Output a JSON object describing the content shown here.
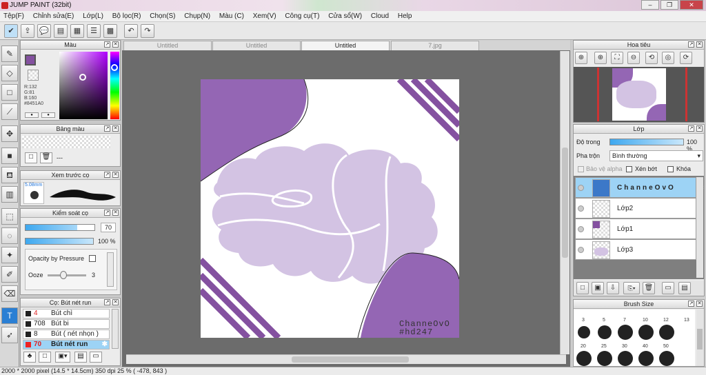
{
  "title": "JUMP PAINT (32bit)",
  "menu": [
    "Tệp(F)",
    "Chỉnh sửa(E)",
    "Lớp(L)",
    "Bộ lọc(R)",
    "Chọn(S)",
    "Chụp(N)",
    "Màu (C)",
    "Xem(V)",
    "Công cụ(T)",
    "Cửa sổ(W)",
    "Cloud",
    "Help"
  ],
  "tabs": [
    "Untitled",
    "Untitled",
    "Untitled",
    "7.jpg"
  ],
  "color_panel": {
    "title": "Màu",
    "r": "R:132",
    "g": "G:81",
    "b": "B:160",
    "hex": "#8451A0",
    "color": "#8451A0"
  },
  "palette_panel": {
    "title": "Bảng màu",
    "placeholder": "---"
  },
  "preview_panel": {
    "title": "Xem trước cọ",
    "size": "5.08mm"
  },
  "brush_control": {
    "title": "Kiểm soát cọ",
    "size_value": "70",
    "opacity_value": "100 %",
    "pressure_label": "Opacity by Pressure",
    "ooze_label": "Ooze",
    "ooze_value": "3",
    "size_fraction": 0.75,
    "opacity_fraction": 1.0,
    "ooze_fraction": 0.4
  },
  "brush_list": {
    "title": "Cọ: Bút nét run",
    "items": [
      {
        "num": "4",
        "label": "Bút chì"
      },
      {
        "num": "708",
        "label": "Bút bi"
      },
      {
        "num": "8",
        "label": "Bút ( nét nhọn )"
      },
      {
        "num": "70",
        "label": "Bút nét run"
      }
    ]
  },
  "navigator": {
    "title": "Hoa tiêu"
  },
  "layers_panel": {
    "title": "Lớp",
    "opacity_label": "Độ trong",
    "opacity_value": "100 %",
    "opacity_fraction": 1.0,
    "blend_label": "Pha trộn",
    "blend_value": "Bình thường",
    "protect_alpha": "Bảo vệ alpha",
    "clip": "Xén bớt",
    "lock": "Khóa",
    "layers": [
      "ChanneOvO",
      "Lớp2",
      "Lớp1",
      "Lớp3"
    ]
  },
  "brush_size_panel": {
    "title": "Brush Size",
    "labels": [
      "3",
      "5",
      "7",
      "10",
      "12",
      "13",
      "20",
      "25",
      "30",
      "40",
      "50"
    ]
  },
  "canvas_text": {
    "line1": "ChanneOvO",
    "line2": "#hd247"
  },
  "status": "2000 * 2000 pixel  (14.5 * 14.5cm)  350 dpi  25 %  ( -478, 843 )",
  "colors": {
    "accent": "#8451A0",
    "light_purple": "#d3c3e3",
    "selection": "#9dd3f5"
  }
}
